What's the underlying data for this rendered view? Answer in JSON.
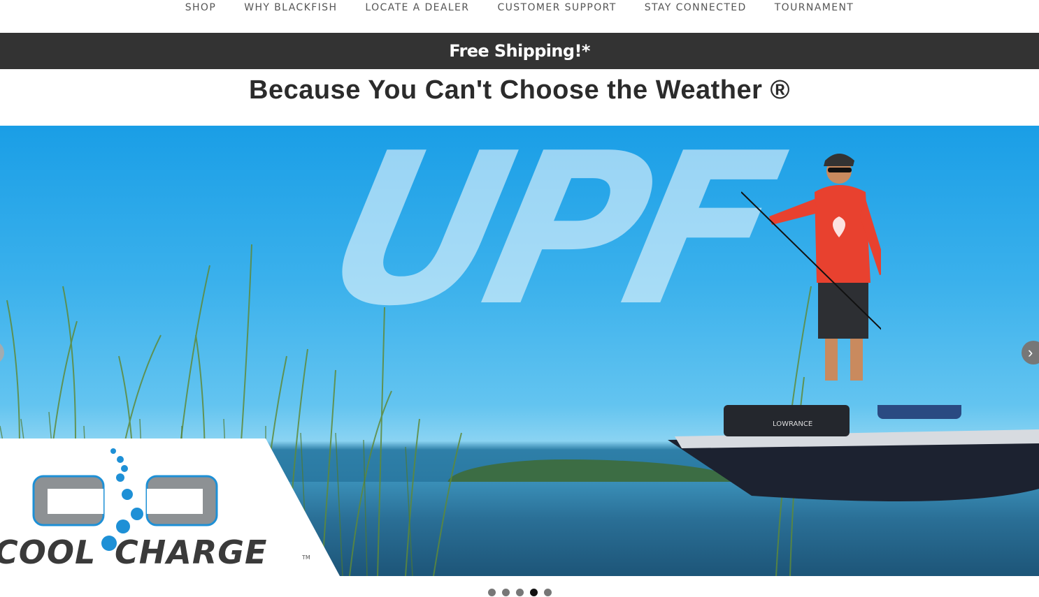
{
  "nav": {
    "items": [
      "SHOP",
      "WHY BLACKFISH",
      "LOCATE A DEALER",
      "CUSTOMER SUPPORT",
      "STAY CONNECTED",
      "TOURNAMENT"
    ]
  },
  "promo": {
    "text": "Free Shipping!*"
  },
  "tagline": "Because You Can't Choose the Weather ®",
  "hero": {
    "overlay_text": "UPF",
    "boat_brand": "LOWRANCE",
    "logo": {
      "word1": "COOL",
      "word2": "CHARGE",
      "tm": "TM"
    },
    "next_icon": "chevron-right-icon",
    "prev_icon": "chevron-left-icon"
  },
  "carousel": {
    "slide_count": 5,
    "active_index": 3
  },
  "colors": {
    "promo_bg": "#333333",
    "sky": "#1a9ee6",
    "logo_blue": "#1e90d6",
    "logo_gray": "#8d9194",
    "shirt": "#e8412f"
  }
}
